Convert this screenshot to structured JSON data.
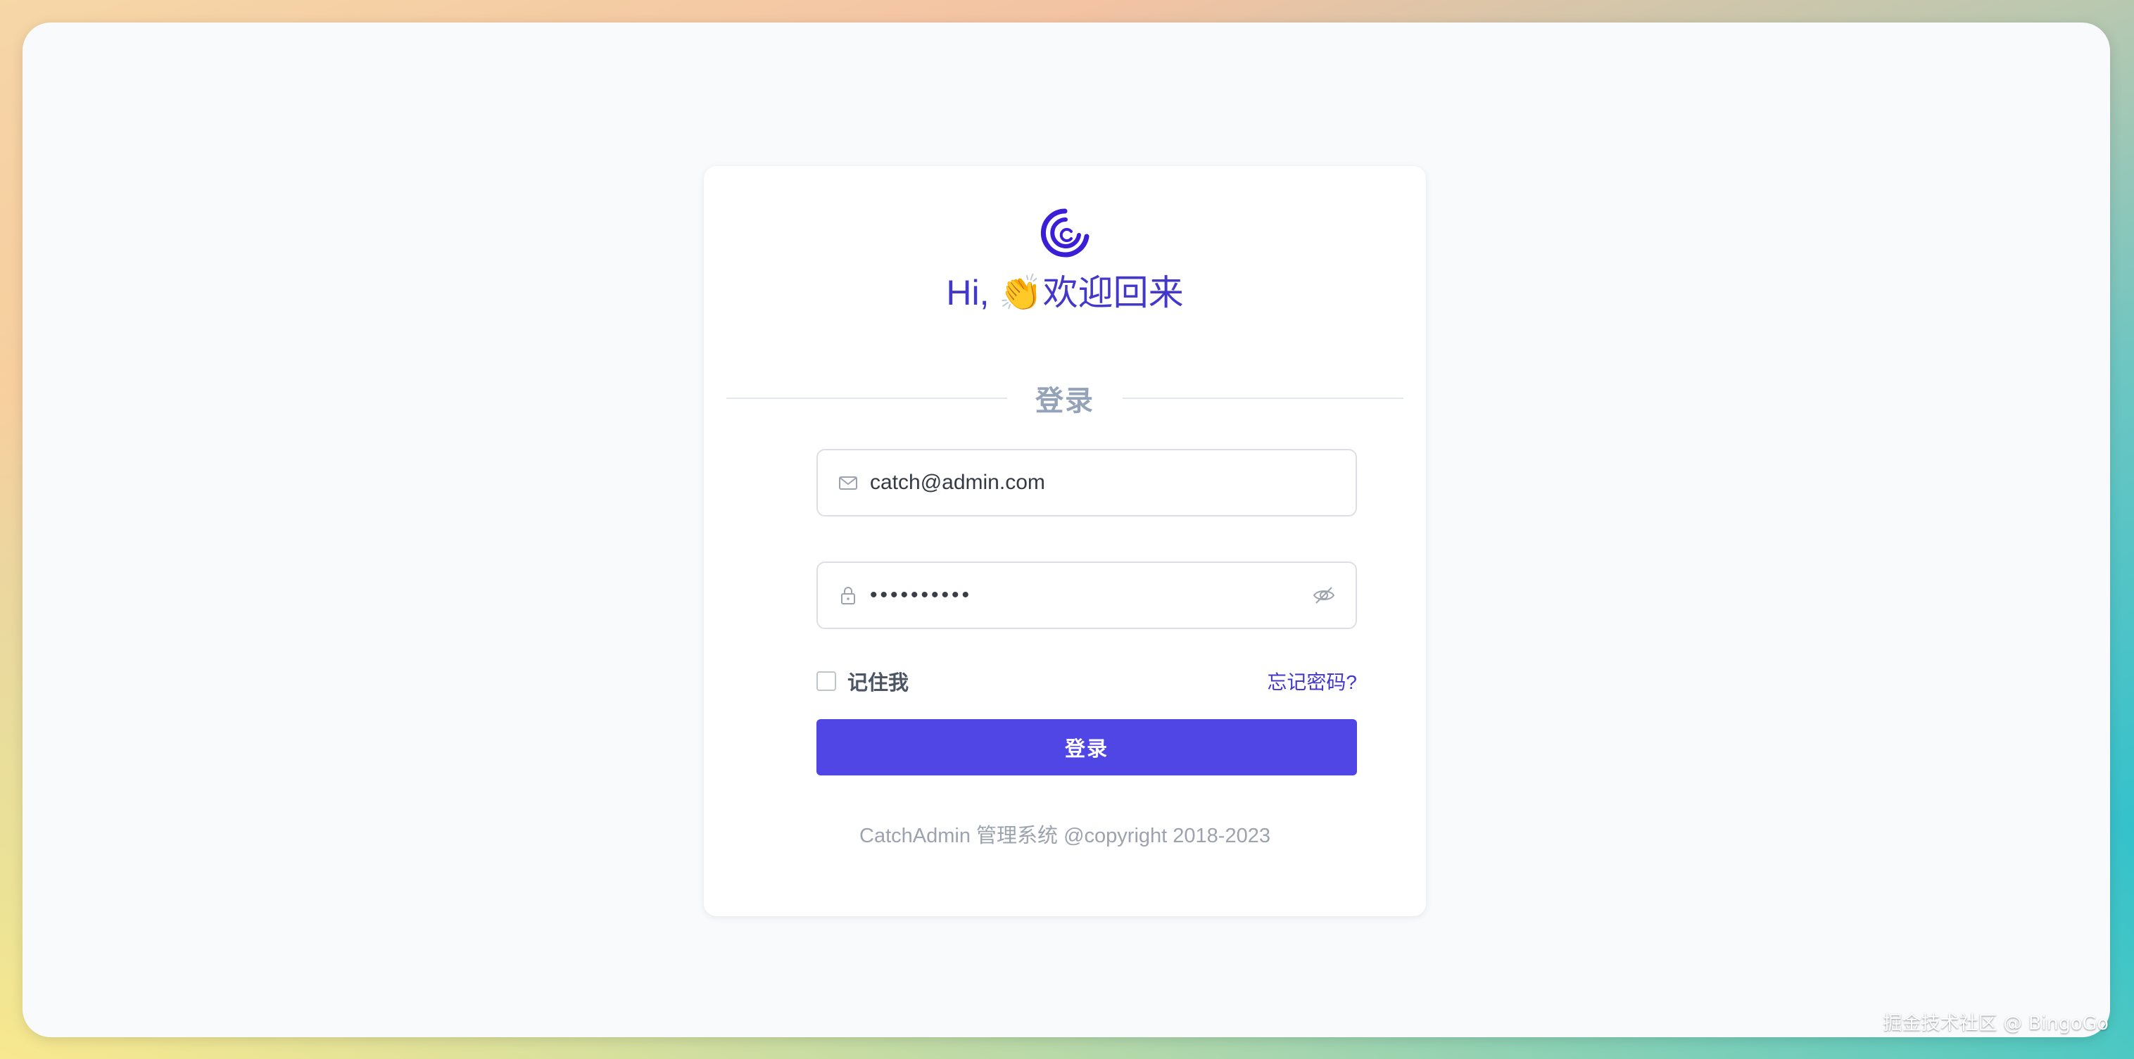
{
  "login": {
    "greeting": "Hi, 👏欢迎回来",
    "divider_label": "登录",
    "email_value": "catch@admin.com",
    "password_masked": "••••••••••",
    "remember_label": "记住我",
    "forgot_label": "忘记密码?",
    "submit_label": "登录",
    "footer": "CatchAdmin 管理系统 @copyright 2018-2023"
  },
  "icons": {
    "logo": "catchadmin-logo",
    "email": "mail-icon",
    "password": "lock-icon",
    "toggle": "eye-off-icon"
  },
  "colors": {
    "accent": "#4f46e5",
    "title": "#4338ca"
  },
  "watermark": "掘金技术社区 @ BingoGo"
}
